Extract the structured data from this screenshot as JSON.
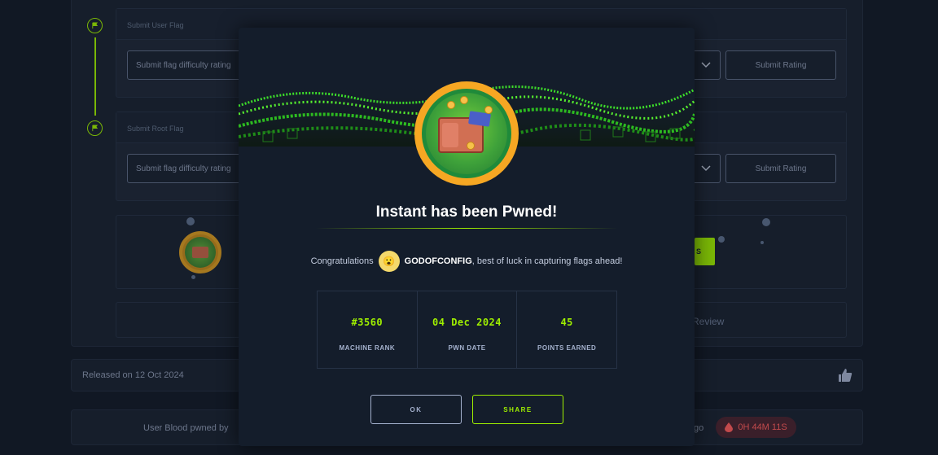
{
  "background": {
    "user_flag_header": "Submit User Flag",
    "root_flag_header": "Submit Root Flag",
    "rating_placeholder": "Submit flag difficulty rating",
    "submit_rating_label": "Submit Rating",
    "green_button_label": "S",
    "review_label": "Review",
    "released_text": "Released on 12 Oct 2024",
    "user_blood_label": "User Blood pwned by",
    "blood_ago_fragment": "go",
    "blood_time": "0H 44M 11S"
  },
  "modal": {
    "title": "Instant has been Pwned!",
    "congrats_prefix": "Congratulations",
    "username": "GODOFCONFIG",
    "congrats_suffix": ", best of luck in capturing flags ahead!",
    "stats": [
      {
        "value": "#3560",
        "label": "MACHINE RANK"
      },
      {
        "value": "04 Dec 2024",
        "label": "PWN DATE"
      },
      {
        "value": "45",
        "label": "POINTS EARNED"
      }
    ],
    "ok_label": "OK",
    "share_label": "SHARE"
  },
  "colors": {
    "accent_green": "#9fef00",
    "background": "#131b28",
    "modal_bg": "#141d2b",
    "blood_red": "#ff5e5e"
  },
  "icons": [
    "flag-icon",
    "chevron-down-icon",
    "thumbs-up-icon",
    "blood-drop-icon",
    "machine-badge-icon",
    "user-avatar-icon"
  ]
}
